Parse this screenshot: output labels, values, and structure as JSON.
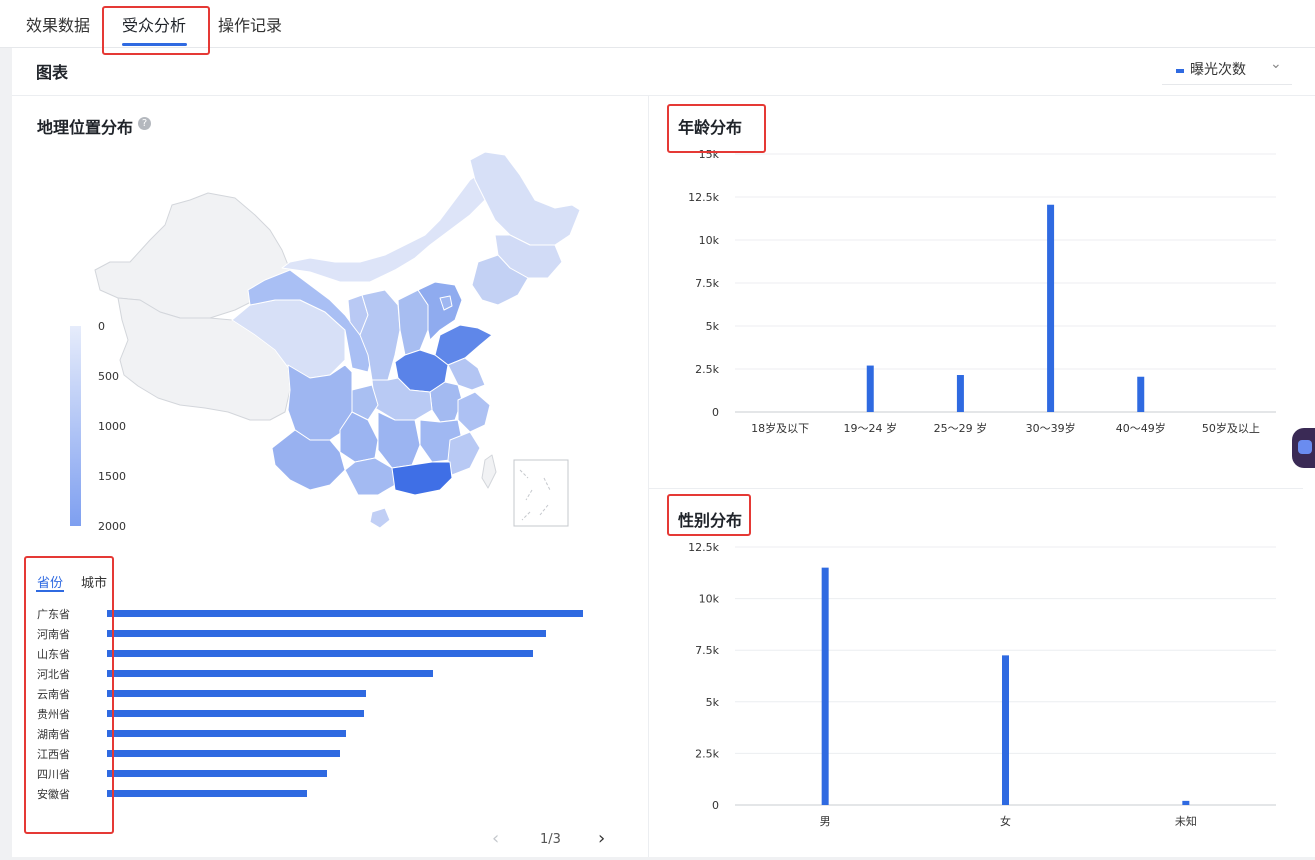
{
  "tabs": [
    {
      "label": "效果数据"
    },
    {
      "label": "受众分析"
    },
    {
      "label": "操作记录"
    }
  ],
  "card": {
    "title": "图表",
    "metric_select": {
      "value": "曝光次数",
      "chevron": "chevron-down-icon"
    }
  },
  "geo": {
    "title": "地理位置分布",
    "help_icon": "question-circle-icon",
    "legend": [
      "0",
      "500",
      "1000",
      "1500",
      "2000"
    ],
    "sub_tabs": [
      "省份",
      "城市"
    ],
    "active_sub_tab": "省份",
    "pagination": {
      "text": "1/3",
      "prev_icon": "chevron-left-icon",
      "next_icon": "chevron-right-icon"
    }
  },
  "age": {
    "title": "年龄分布"
  },
  "gender": {
    "title": "性别分布"
  },
  "chart_data": [
    {
      "id": "province",
      "type": "bar",
      "orientation": "horizontal",
      "categories": [
        "广东省",
        "河南省",
        "山东省",
        "河北省",
        "云南省",
        "贵州省",
        "湖南省",
        "江西省",
        "四川省",
        "安徽省"
      ],
      "values": [
        2000,
        1845,
        1790,
        1370,
        1090,
        1080,
        1005,
        980,
        925,
        840
      ],
      "color": "#2f6ae1"
    },
    {
      "id": "age",
      "type": "bar",
      "title": "年龄分布",
      "categories": [
        "18岁及以下",
        "19～24 岁",
        "25～29 岁",
        "30～39岁",
        "40～49岁",
        "50岁及以上"
      ],
      "values": [
        0,
        2700,
        2150,
        12050,
        2050,
        0
      ],
      "yticks": [
        "0",
        "2.5k",
        "5k",
        "7.5k",
        "10k",
        "12.5k",
        "15k"
      ],
      "ylim": [
        0,
        15000
      ],
      "grid": true,
      "color": "#2f6ae1"
    },
    {
      "id": "gender",
      "type": "bar",
      "title": "性别分布",
      "categories": [
        "男",
        "女",
        "未知"
      ],
      "values": [
        11500,
        7250,
        200
      ],
      "yticks": [
        "0",
        "2.5k",
        "5k",
        "7.5k",
        "10k",
        "12.5k"
      ],
      "ylim": [
        0,
        12500
      ],
      "grid": true,
      "color": "#2f6ae1"
    }
  ]
}
